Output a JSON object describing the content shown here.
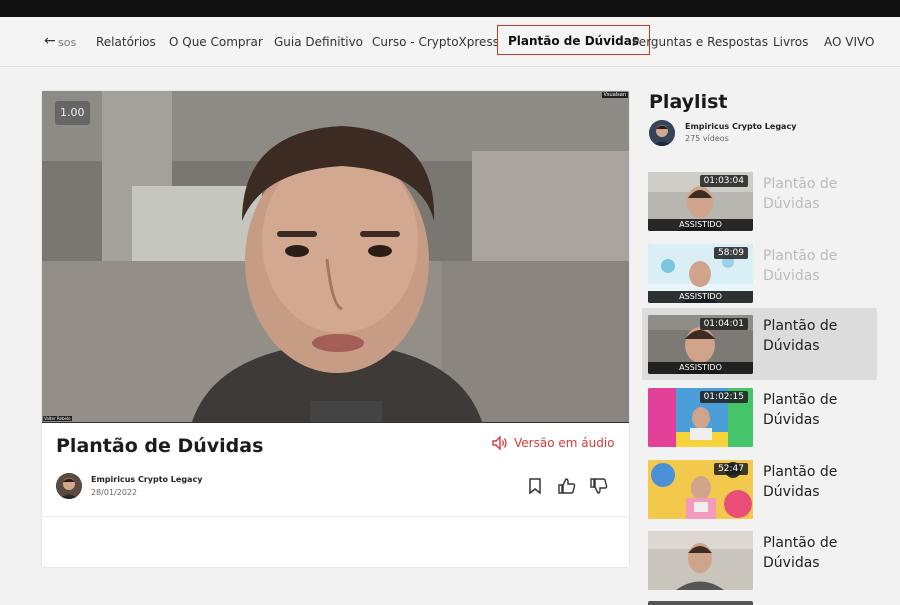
{
  "nav": {
    "back_text": "sos",
    "items": [
      "Relatórios",
      "O Que Comprar",
      "Guia Definitivo",
      "Curso - CryptoXpress",
      "Plantão de Dúvidas",
      "Perguntas e Respostas",
      "Livros",
      "AO VIVO"
    ],
    "active": "Plantão de Dúvidas"
  },
  "video": {
    "speed": "1.00",
    "watermark": "Vsualsan",
    "participant": "Valter Rebelo",
    "title": "Plantão de Dúvidas",
    "audio_label": "Versão em áudio",
    "author": "Empiricus Crypto Legacy",
    "date": "28/01/2022"
  },
  "playlist": {
    "title": "Playlist",
    "channel": "Empiricus Crypto Legacy",
    "count": "275 vídeos",
    "items": [
      {
        "duration": "01:03:04",
        "label": "Plantão de Dúvidas",
        "watched": "ASSISTIDO"
      },
      {
        "duration": "58:09",
        "label": "Plantão de Dúvidas",
        "watched": "ASSISTIDO"
      },
      {
        "duration": "01:04:01",
        "label": "Plantão de Dúvidas",
        "watched": "ASSISTIDO"
      },
      {
        "duration": "01:02:15",
        "label": "Plantão de Dúvidas"
      },
      {
        "duration": "52:47",
        "label": "Plantão de Dúvidas"
      },
      {
        "label": "Plantão de Dúvidas"
      }
    ]
  },
  "colors": {
    "accent": "#d9393b",
    "active_border": "#c0392b"
  }
}
